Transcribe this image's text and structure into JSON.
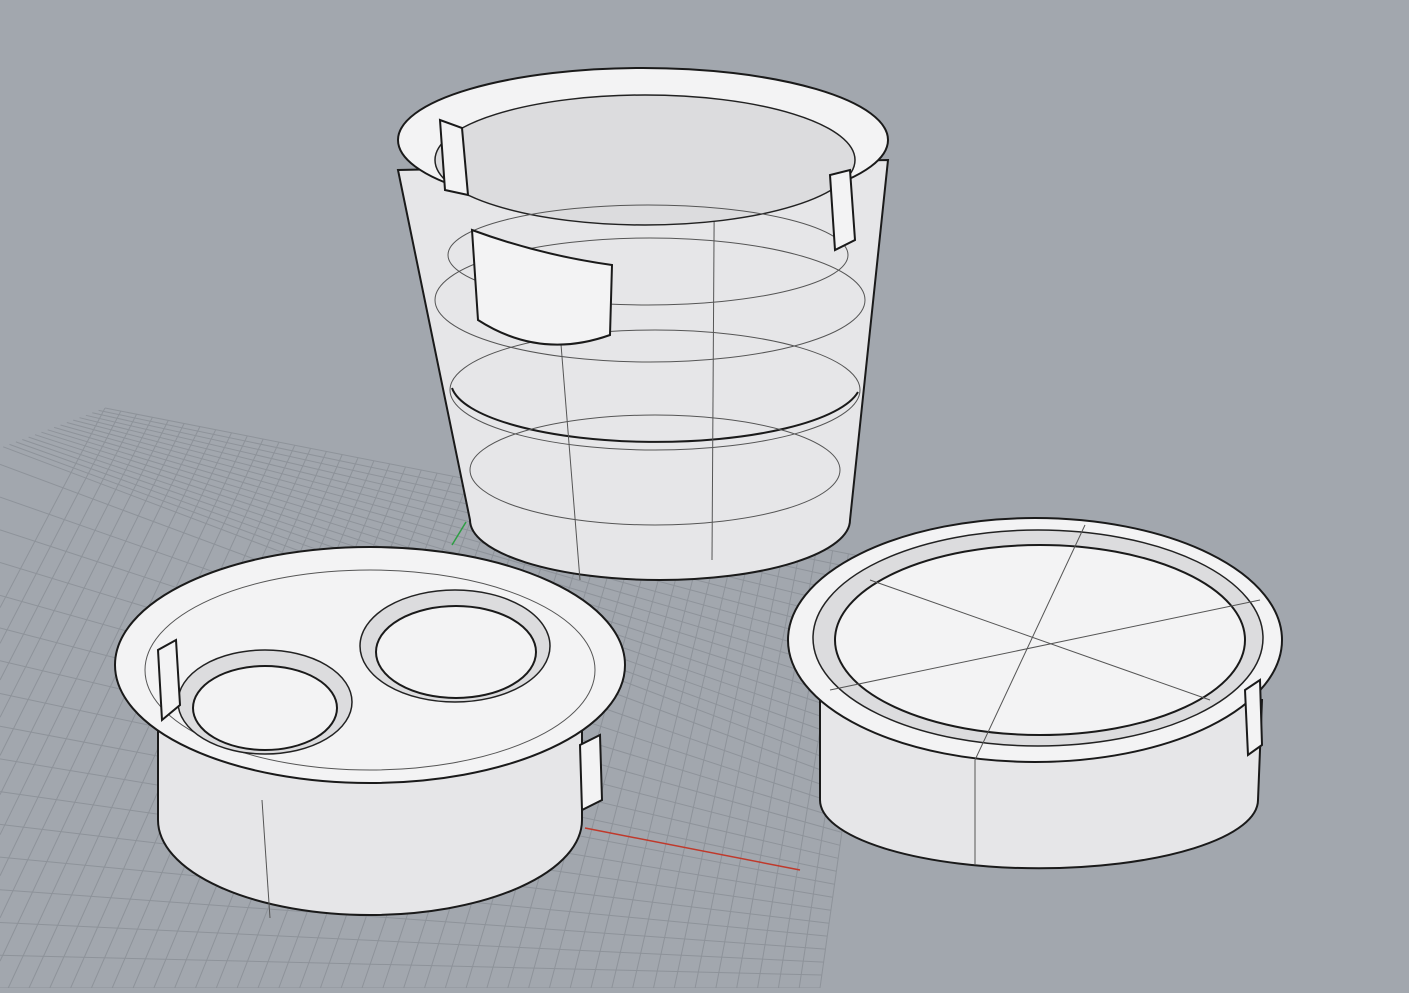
{
  "viewport": {
    "background_color": "#a2a7ae",
    "grid_color": "#8e939a",
    "x_axis_color": "#c0392b",
    "y_axis_color": "#2e9e44",
    "objects": [
      "cup",
      "lid-with-two-holes",
      "plain-lid"
    ]
  }
}
